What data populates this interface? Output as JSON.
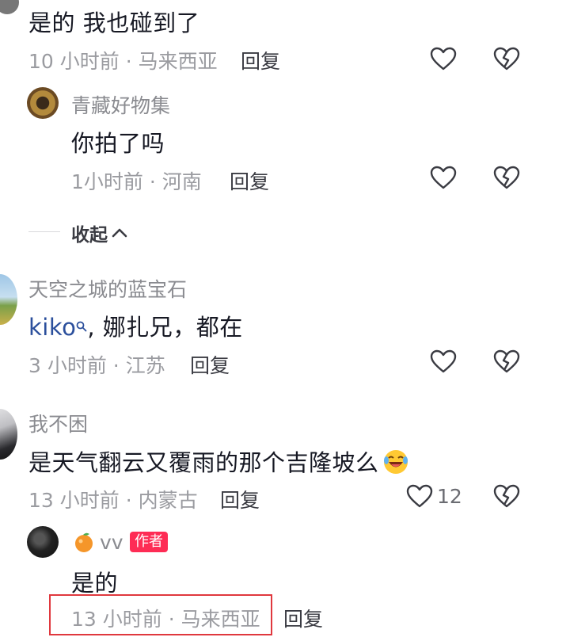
{
  "c1": {
    "text": "是的 我也碰到了",
    "meta": "10 小时前 · 马来西亚",
    "reply": "回复"
  },
  "r1": {
    "user": "青藏好物集",
    "text": "你拍了吗",
    "meta": "1小时前 · 河南",
    "reply": "回复"
  },
  "collapse": {
    "label": "收起"
  },
  "c2": {
    "user": "天空之城的蓝宝石",
    "mention": "kiko",
    "text": ", 娜扎兄，都在",
    "meta": "3 小时前 · 江苏",
    "reply": "回复"
  },
  "c3": {
    "user": "我不困",
    "text": "是天气翻云又覆雨的那个吉隆坡么",
    "meta": "13 小时前 · 内蒙古",
    "reply": "回复",
    "likes": "12"
  },
  "r3": {
    "user": "vv",
    "badge": "作者",
    "text": "是的",
    "meta": "13 小时前 · 马来西亚",
    "reply": "回复"
  },
  "colors": {
    "accent": "#fe2c55",
    "mention": "#2b4f9c",
    "highlight": "#e0383e"
  }
}
